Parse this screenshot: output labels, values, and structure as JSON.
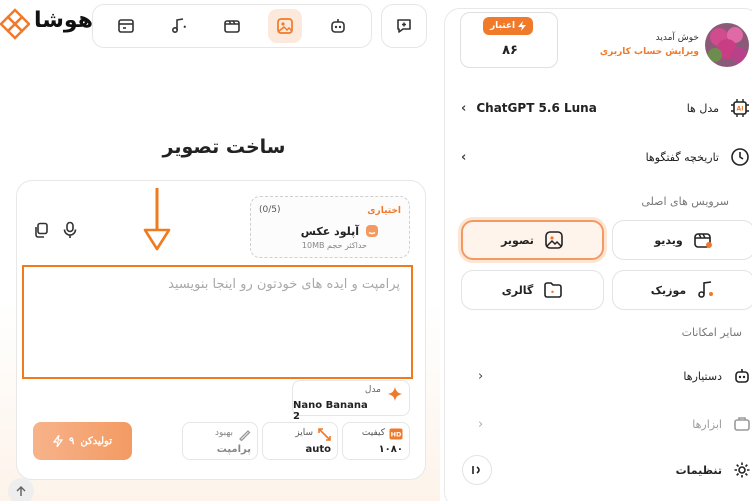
{
  "app": {
    "logo_text": "هوشا"
  },
  "topbar": {
    "items": [
      {
        "name": "files-icon"
      },
      {
        "name": "music-icon"
      },
      {
        "name": "video-icon"
      },
      {
        "name": "image-icon",
        "active": true
      },
      {
        "name": "robot-icon"
      }
    ]
  },
  "main": {
    "title": "ساخت تصویر",
    "upload": {
      "optional_label": "اختیاری",
      "count": "(0/5)",
      "title": "آپلود عکس",
      "hint": "حداکثر حجم 10MB"
    },
    "prompt": {
      "value": "",
      "placeholder": "پرامپت و ایده های خودتون رو اینجا بنویسید"
    },
    "model": {
      "label": "مدل",
      "value": "Nano Banana 2"
    },
    "options": {
      "quality": {
        "label": "کیفیت",
        "value": "۱۰۸۰",
        "icon_text": "HD"
      },
      "size": {
        "label": "سایز",
        "value": "auto"
      },
      "improve": {
        "label": "بهبود",
        "value": "پرامپت"
      }
    },
    "generate": {
      "label": "تولیدکن",
      "cost": "۹"
    }
  },
  "sidebar": {
    "welcome": "خوش آمدید",
    "edit_account": "ویرایش حساب کاربری",
    "credit": {
      "label": "اعتبار",
      "value": "۸۶"
    },
    "models": {
      "label": "مدل ها",
      "value": "ChatGPT 5.6 Luna"
    },
    "history": {
      "label": "تاریخچه گفتگوها"
    },
    "main_services_title": "سرویس های اصلی",
    "services": {
      "image": "تصویر",
      "video": "ویدیو",
      "gallery": "گالری",
      "music": "موزیک"
    },
    "other_title": "سایر امکانات",
    "assistants": "دستیارها",
    "tools": "ابزارها",
    "settings": "تنظیمات"
  },
  "colors": {
    "accent": "#f07a2a",
    "highlight": "#f07a1e"
  }
}
